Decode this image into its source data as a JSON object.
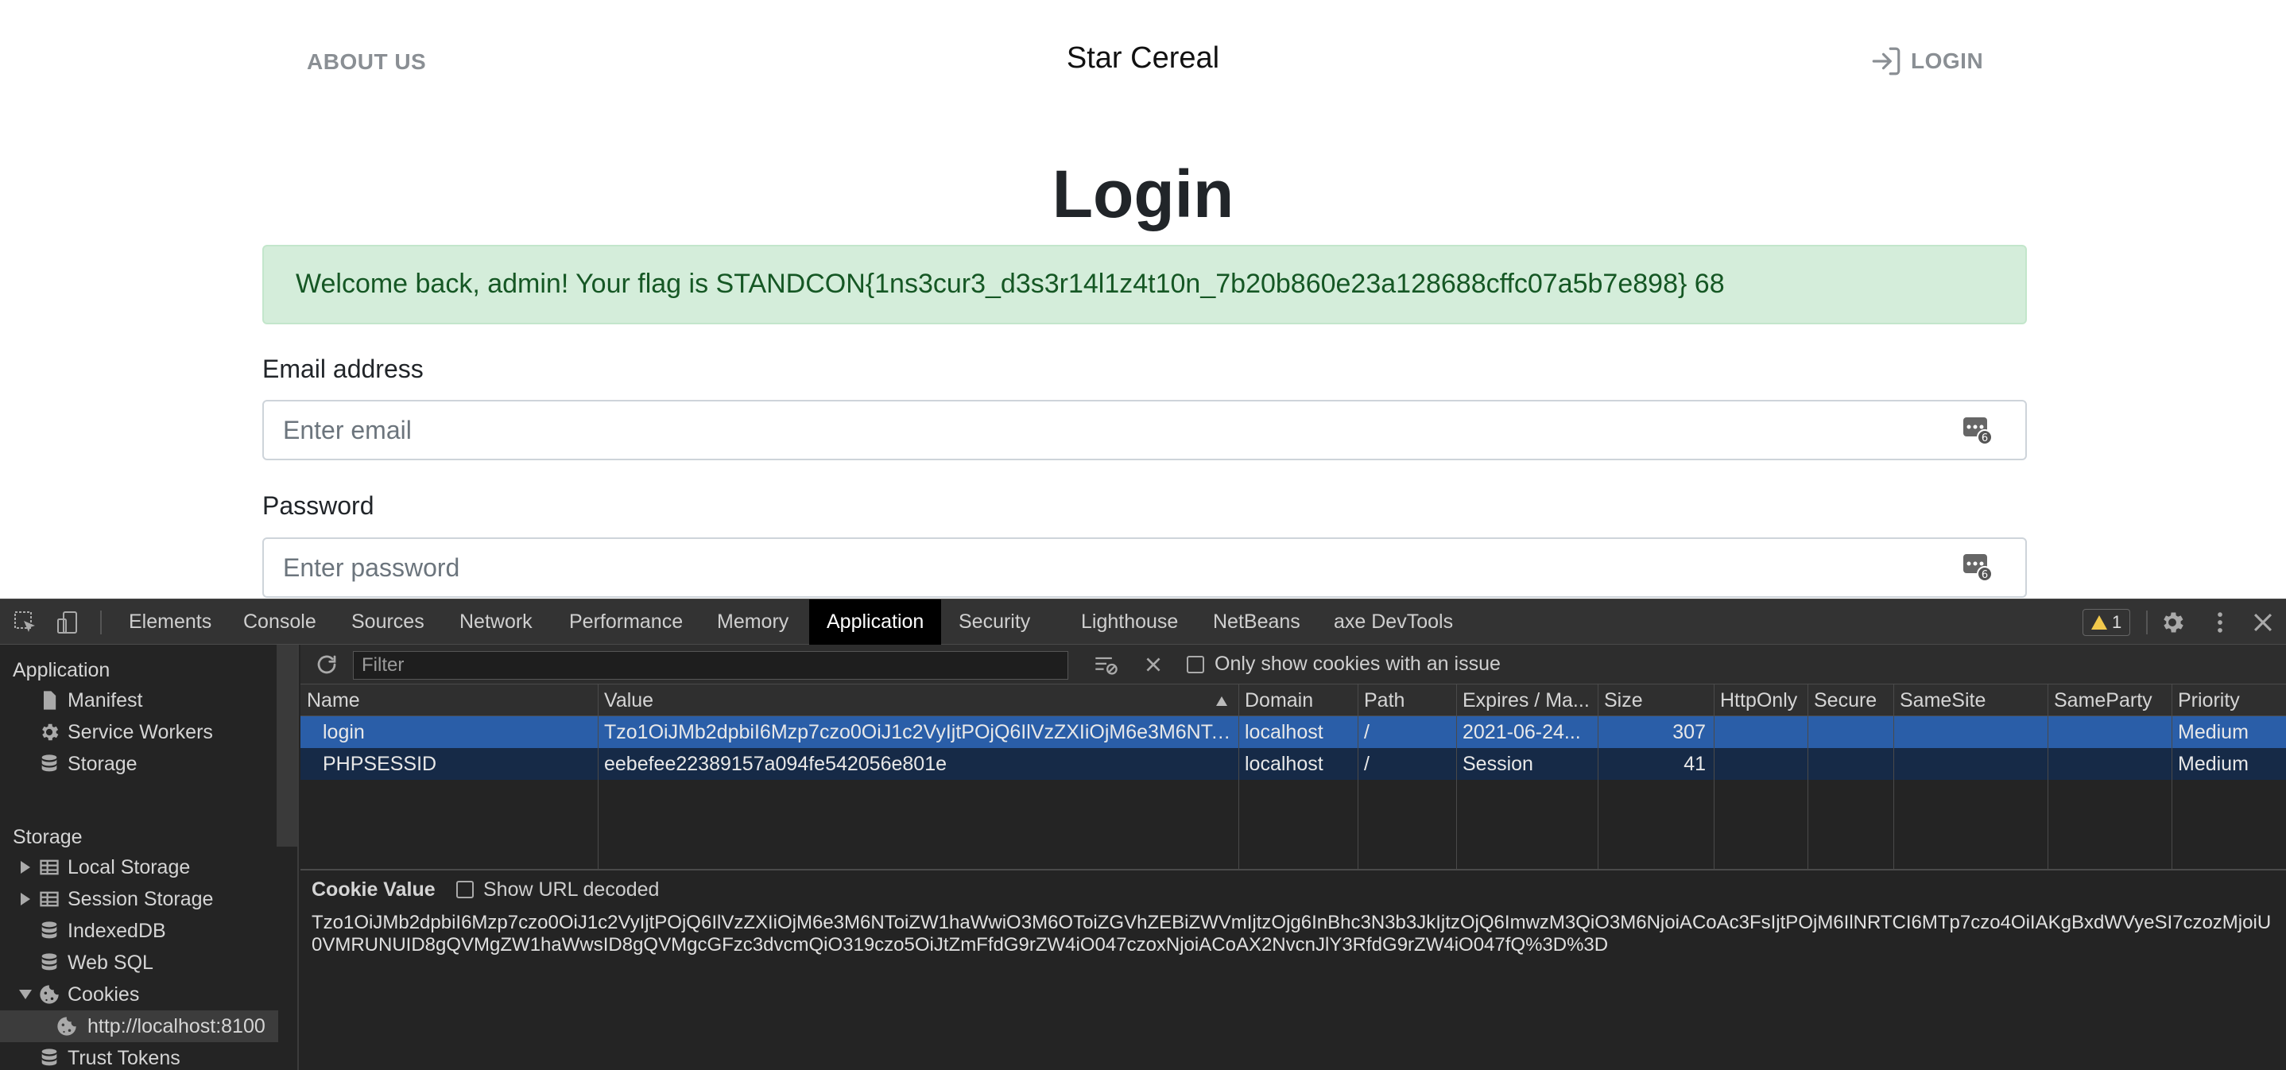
{
  "page": {
    "nav_about": "ABOUT US",
    "brand": "Star Cereal",
    "nav_login": "LOGIN",
    "title": "Login",
    "alert": "Welcome back, admin! Your flag is STANDCON{1ns3cur3_d3s3r14l1z4t10n_7b20b860e23a128688cffc07a5b7e898} 68",
    "email_label": "Email address",
    "email_placeholder": "Enter email",
    "password_label": "Password",
    "password_placeholder": "Enter password",
    "autofill_badge": "6"
  },
  "devtools": {
    "tabs": [
      "Elements",
      "Console",
      "Sources",
      "Network",
      "Performance",
      "Memory",
      "Application",
      "Security",
      "Lighthouse",
      "NetBeans",
      "axe DevTools"
    ],
    "active_tab": "Application",
    "warning_count": "1",
    "sidebar": {
      "application_header": "Application",
      "application_items": [
        "Manifest",
        "Service Workers",
        "Storage"
      ],
      "storage_header": "Storage",
      "storage_items": [
        "Local Storage",
        "Session Storage",
        "IndexedDB",
        "Web SQL",
        "Cookies"
      ],
      "cookie_origin": "http://localhost:8100",
      "trust_tokens": "Trust Tokens"
    },
    "filter": {
      "placeholder": "Filter",
      "only_issues_label": "Only show cookies with an issue"
    },
    "columns": [
      "Name",
      "Value",
      "Domain",
      "Path",
      "Expires / Ma...",
      "Size",
      "HttpOnly",
      "Secure",
      "SameSite",
      "SameParty",
      "Priority"
    ],
    "rows": [
      {
        "name": "login",
        "value": "Tzo1OiJMb2dpbiI6Mzp7czo0OiJ1c2VyIjtPOjQ6IlVzZXIiOjM6e3M6NToi...",
        "domain": "localhost",
        "path": "/",
        "expires": "2021-06-24...",
        "size": "307",
        "httponly": "",
        "secure": "",
        "samesite": "",
        "sameparty": "",
        "priority": "Medium"
      },
      {
        "name": "PHPSESSID",
        "value": "eebefee22389157a094fe542056e801e",
        "domain": "localhost",
        "path": "/",
        "expires": "Session",
        "size": "41",
        "httponly": "",
        "secure": "",
        "samesite": "",
        "sameparty": "",
        "priority": "Medium"
      }
    ],
    "cookie_value": {
      "title": "Cookie Value",
      "decode_label": "Show URL decoded",
      "value": "Tzo1OiJMb2dpbiI6Mzp7czo0OiJ1c2VyIjtPOjQ6IlVzZXIiOjM6e3M6NToiZW1haWwiO3M6OToiZGVhZEBiZWVmIjtzOjg6InBhc3N3b3JkIjtzOjQ6ImwzM3QiO3M6NjoiACoAc3FsIjtPOjM6IlNRTCI6MTp7czo4OiIAKgBxdWVyeSI7czozMjoiU0VMRUNUID8gQVMgZW1haWwsID8gQVMgcGFzc3dvcmQiO319czo5OiJtZmFfdG9rZW4iO047czoxNjoiACoAX2NvcnJlY3RfdG9rZW4iO047fQ%3D%3D"
    }
  }
}
